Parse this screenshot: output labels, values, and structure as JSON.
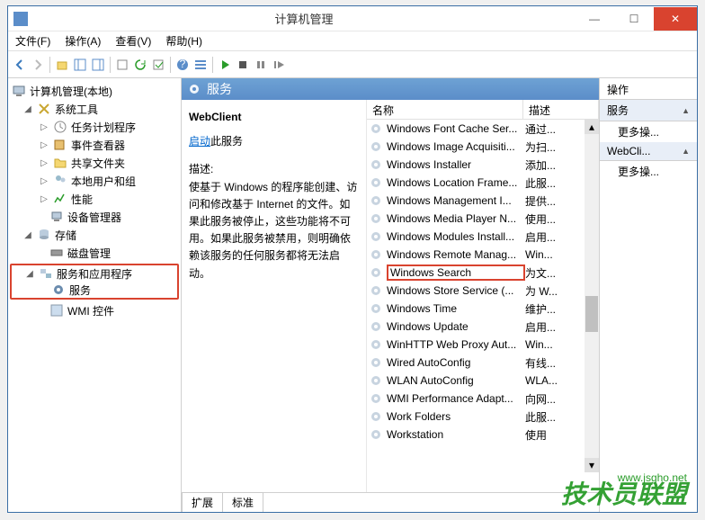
{
  "window": {
    "title": "计算机管理"
  },
  "menu": {
    "file": "文件(F)",
    "action": "操作(A)",
    "view": "查看(V)",
    "help": "帮助(H)"
  },
  "tree": {
    "root": "计算机管理(本地)",
    "system_tools": "系统工具",
    "task_scheduler": "任务计划程序",
    "event_viewer": "事件查看器",
    "shared_folders": "共享文件夹",
    "local_users": "本地用户和组",
    "performance": "性能",
    "device_manager": "设备管理器",
    "storage": "存储",
    "disk_mgmt": "磁盘管理",
    "services_apps": "服务和应用程序",
    "services": "服务",
    "wmi": "WMI 控件"
  },
  "mid": {
    "header": "服务",
    "selected": "WebClient",
    "start_link": "启动",
    "start_rest": "此服务",
    "desc_label": "描述:",
    "desc_text": "使基于 Windows 的程序能创建、访问和修改基于 Internet 的文件。如果此服务被停止，这些功能将不可用。如果此服务被禁用，则明确依赖该服务的任何服务都将无法启动。"
  },
  "list": {
    "col_name": "名称",
    "col_desc": "描述",
    "items": [
      {
        "n": "Windows Font Cache Ser...",
        "d": "通过..."
      },
      {
        "n": "Windows Image Acquisiti...",
        "d": "为扫..."
      },
      {
        "n": "Windows Installer",
        "d": "添加..."
      },
      {
        "n": "Windows Location Frame...",
        "d": "此服..."
      },
      {
        "n": "Windows Management I...",
        "d": "提供..."
      },
      {
        "n": "Windows Media Player N...",
        "d": "使用..."
      },
      {
        "n": "Windows Modules Install...",
        "d": "启用..."
      },
      {
        "n": "Windows Remote Manag...",
        "d": "Win..."
      },
      {
        "n": "Windows Search",
        "d": "为文...",
        "hl": true
      },
      {
        "n": "Windows Store Service (...",
        "d": "为 W..."
      },
      {
        "n": "Windows Time",
        "d": "维护..."
      },
      {
        "n": "Windows Update",
        "d": "启用..."
      },
      {
        "n": "WinHTTP Web Proxy Aut...",
        "d": "Win..."
      },
      {
        "n": "Wired AutoConfig",
        "d": "有线..."
      },
      {
        "n": "WLAN AutoConfig",
        "d": "WLA..."
      },
      {
        "n": "WMI Performance Adapt...",
        "d": "向网..."
      },
      {
        "n": "Work Folders",
        "d": "此服..."
      },
      {
        "n": "Workstation",
        "d": "使用"
      }
    ]
  },
  "tabs": {
    "ext": "扩展",
    "std": "标准"
  },
  "actions": {
    "title": "操作",
    "h1": "服务",
    "more1": "更多操...",
    "h2": "WebCli...",
    "more2": "更多操..."
  },
  "watermark": {
    "main": "技术员联盟",
    "sub": "www.jsgho.net"
  }
}
